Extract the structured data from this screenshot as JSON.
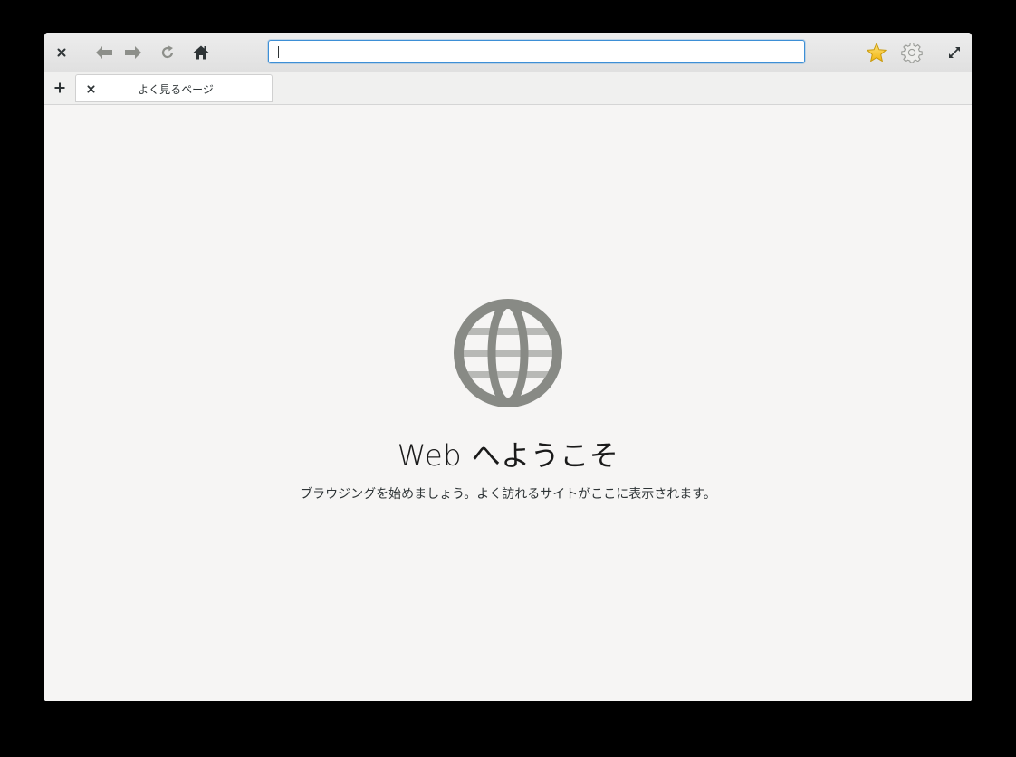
{
  "browser": {
    "url_value": "",
    "tab": {
      "title": "よく見るページ"
    }
  },
  "icons": {
    "close": "close-icon",
    "back": "arrow-left-icon",
    "forward": "arrow-right-icon",
    "reload": "reload-icon",
    "home": "home-icon",
    "bookmark": "star-icon",
    "settings": "gear-icon",
    "fullscreen": "fullscreen-icon",
    "new_tab": "plus-icon",
    "tab_close": "close-icon",
    "welcome": "globe-icon"
  },
  "colors": {
    "accent": "#3d8fd6",
    "star": "#f5c211",
    "globe": "#888a85",
    "background": "#f6f5f4"
  },
  "welcome": {
    "title": "Web へようこそ",
    "subtitle": "ブラウジングを始めましょう。よく訪れるサイトがここに表示されます。"
  }
}
